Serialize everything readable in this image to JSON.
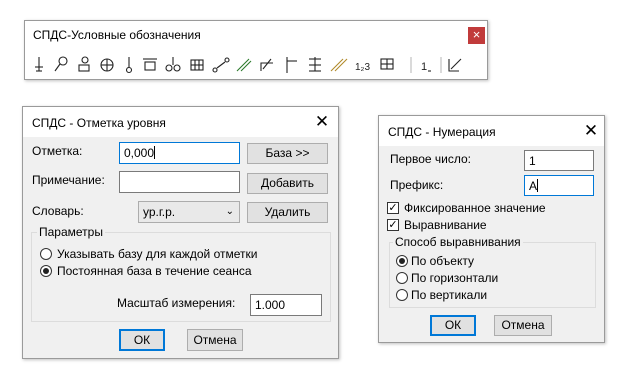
{
  "toolbar": {
    "title": "СПДС-Условные обозначения",
    "close_label": "×",
    "icons": [
      "axis-marker-icon",
      "leader-note-icon",
      "stamp-marker-icon",
      "crosshair-circle-icon",
      "pin-marker-icon",
      "frame-marker-icon",
      "section-symbol-icon",
      "grid-hatch-icon",
      "node-link-icon",
      "slope-arrow-icon",
      "corner-arrow-icon",
      "flag-marker-icon",
      "stack-marker-icon",
      "hatch-lines-icon",
      "numbering-icon",
      "table-marker-icon",
      "level-mark-icon",
      "edit-marker-icon"
    ],
    "accent": "#c13b3b"
  },
  "level_dialog": {
    "title": "СПДС - Отметка уровня",
    "mark_label": "Отметка:",
    "mark_value": "0,000",
    "base_button": "База >>",
    "note_label": "Примечание:",
    "note_value": "",
    "add_button": "Добавить",
    "dict_label": "Словарь:",
    "dict_value": "ур.г.р.",
    "delete_button": "Удалить",
    "params_group": "Параметры",
    "option_each": "Указывать базу для каждой отметки",
    "option_session": "Постоянная база в течение сеанса",
    "selected_option": "session",
    "scale_label": "Масштаб измерения:",
    "scale_value": "1.000",
    "ok": "ОК",
    "cancel": "Отмена"
  },
  "numbering_dialog": {
    "title": "СПДС - Нумерация",
    "first_label": "Первое число:",
    "first_value": "1",
    "prefix_label": "Префикс:",
    "prefix_value": "A",
    "fixed_label": "Фиксированное значение",
    "fixed_checked": true,
    "align_label": "Выравнивание",
    "align_checked": true,
    "method_group": "Способ выравнивания",
    "by_object": "По объекту",
    "by_horizontal": "По горизонтали",
    "by_vertical": "По вертикали",
    "selected_method": "by_object",
    "ok": "ОК",
    "cancel": "Отмена"
  }
}
